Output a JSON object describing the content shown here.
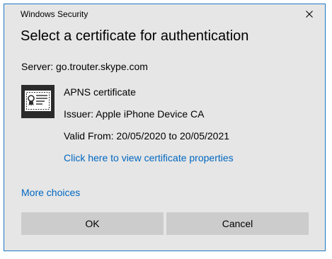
{
  "window": {
    "title": "Windows Security",
    "close_icon": "close-icon"
  },
  "dialog": {
    "heading": "Select a certificate for authentication",
    "server_line": "Server: go.trouter.skype.com"
  },
  "certificate": {
    "icon": "certificate-icon",
    "name": "APNS certificate",
    "issuer": "Issuer: Apple iPhone Device CA",
    "valid": "Valid From: 20/05/2020 to 20/05/2021",
    "properties_link": "Click here to view certificate properties"
  },
  "more_choices_link": "More choices",
  "buttons": {
    "ok": "OK",
    "cancel": "Cancel"
  },
  "colors": {
    "accent_border": "#1e78c8",
    "link": "#0067c0",
    "dialog_background": "#e6e6e6",
    "button_background": "#cccccc",
    "icon_tile": "#2b2b2b"
  }
}
